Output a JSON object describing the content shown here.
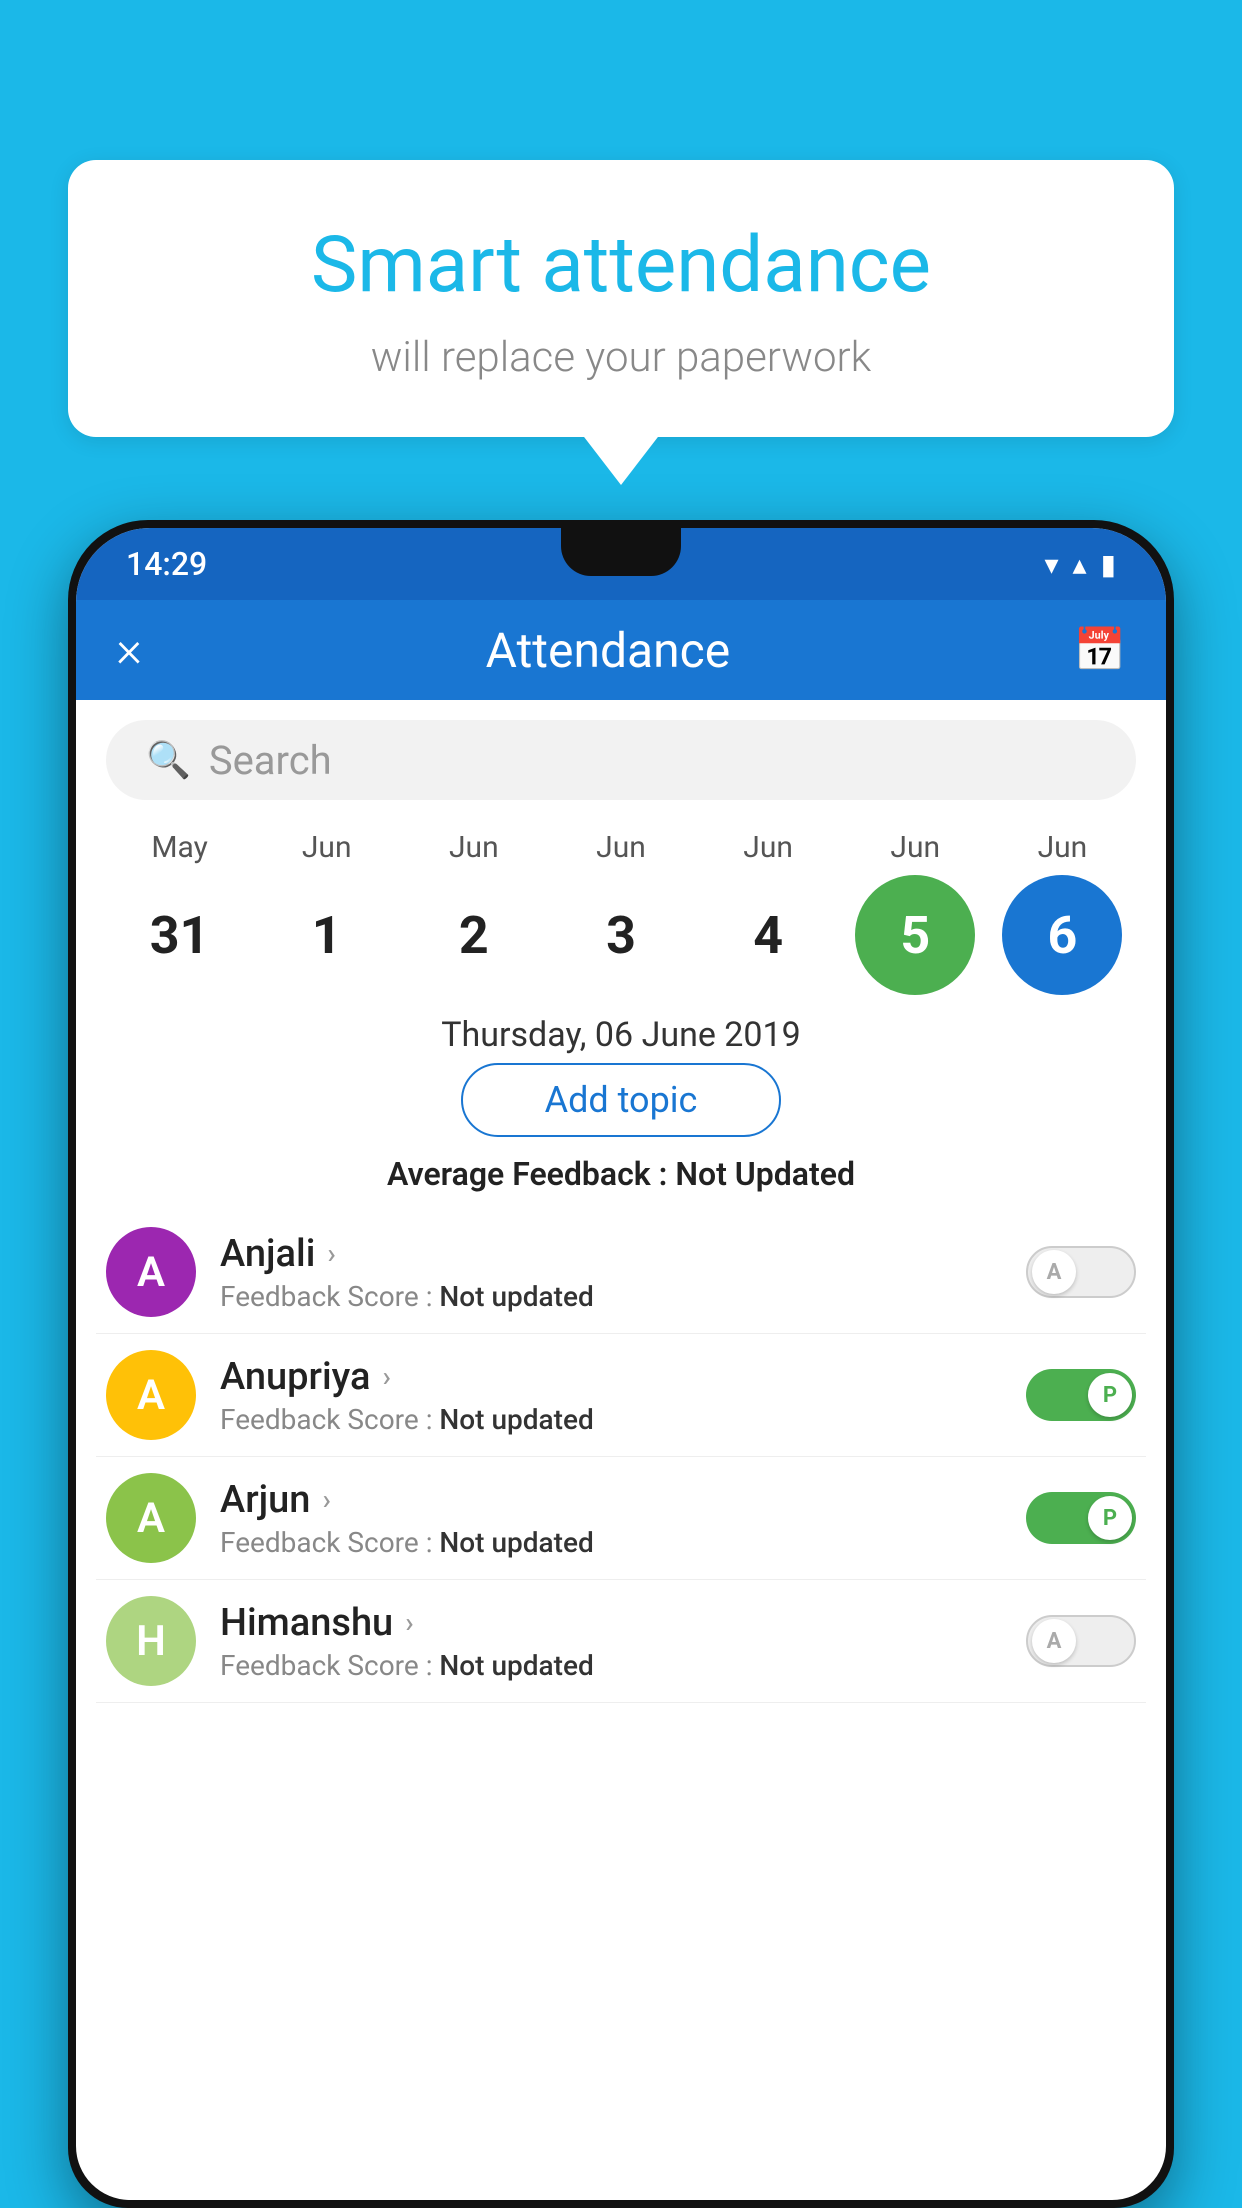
{
  "background_color": "#1BB8E8",
  "bubble": {
    "title": "Smart attendance",
    "subtitle": "will replace your paperwork"
  },
  "status_bar": {
    "time": "14:29",
    "wifi": "▾",
    "signal": "▴",
    "battery": "▮"
  },
  "header": {
    "title": "Attendance",
    "close_label": "×",
    "calendar_icon": "📅"
  },
  "search": {
    "placeholder": "Search"
  },
  "calendar": {
    "months": [
      "May",
      "Jun",
      "Jun",
      "Jun",
      "Jun",
      "Jun",
      "Jun"
    ],
    "dates": [
      "31",
      "1",
      "2",
      "3",
      "4",
      "5",
      "6"
    ],
    "active_green_index": 5,
    "active_blue_index": 6
  },
  "selected_date": "Thursday, 06 June 2019",
  "add_topic_label": "Add topic",
  "avg_feedback": {
    "label": "Average Feedback : ",
    "value": "Not Updated"
  },
  "students": [
    {
      "name": "Anjali",
      "avatar_letter": "A",
      "avatar_color": "#9C27B0",
      "feedback_label": "Feedback Score : ",
      "feedback_value": "Not updated",
      "toggle_state": "off",
      "toggle_label": "A"
    },
    {
      "name": "Anupriya",
      "avatar_letter": "A",
      "avatar_color": "#FFC107",
      "feedback_label": "Feedback Score : ",
      "feedback_value": "Not updated",
      "toggle_state": "on",
      "toggle_label": "P"
    },
    {
      "name": "Arjun",
      "avatar_letter": "A",
      "avatar_color": "#8BC34A",
      "feedback_label": "Feedback Score : ",
      "feedback_value": "Not updated",
      "toggle_state": "on",
      "toggle_label": "P"
    },
    {
      "name": "Himanshu",
      "avatar_letter": "H",
      "avatar_color": "#AED581",
      "feedback_label": "Feedback Score : ",
      "feedback_value": "Not updated",
      "toggle_state": "off",
      "toggle_label": "A"
    }
  ]
}
